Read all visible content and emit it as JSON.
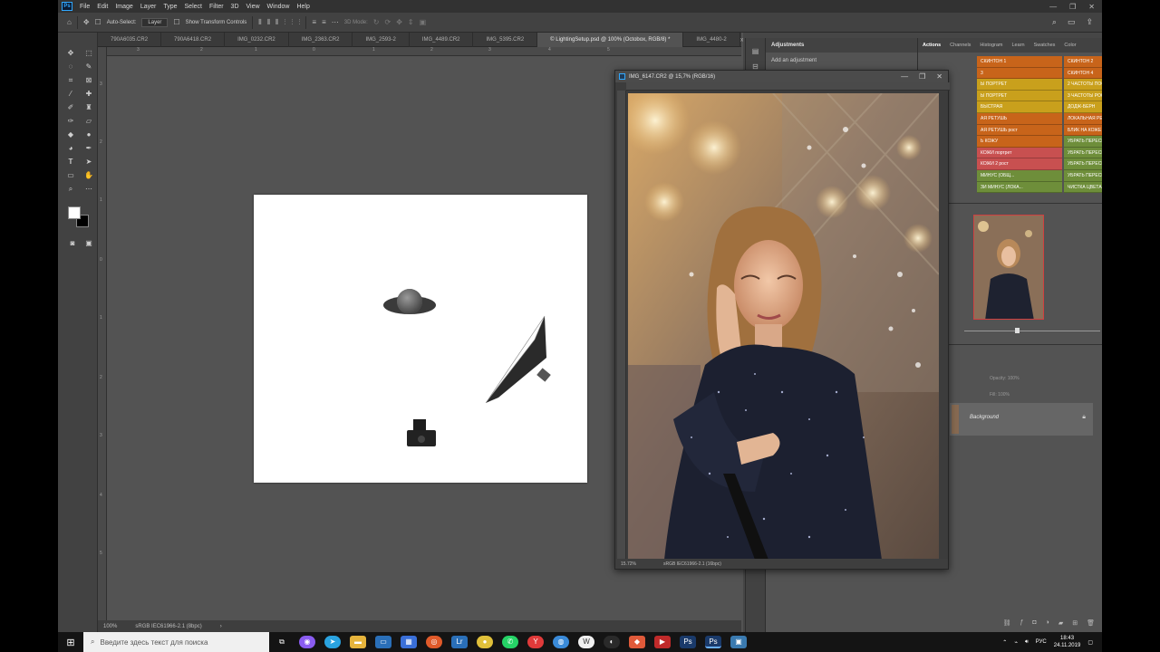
{
  "app": {
    "logo": "Ps",
    "menu": [
      "File",
      "Edit",
      "Image",
      "Layer",
      "Type",
      "Select",
      "Filter",
      "3D",
      "View",
      "Window",
      "Help"
    ],
    "window_controls": [
      "—",
      "❐",
      "✕"
    ]
  },
  "options_bar": {
    "auto_select_label": "Auto-Select:",
    "auto_select_value": "Layer",
    "transform_label": "Show Transform Controls",
    "mode_label": "3D Mode:"
  },
  "tabs": [
    "790A6035.CR2",
    "790A6418.CR2",
    "IMG_0232.CR2",
    "IMG_2363.CR2",
    "IMG_2593-2",
    "IMG_4489.CR2",
    "IMG_5395.CR2",
    "© LightingSetup.psd @ 100% (Octobox, RGB/8) *",
    "IMG_4480-2"
  ],
  "status_main": {
    "zoom": "100%",
    "profile": "sRGB IEC61966-2.1 (8bpc)"
  },
  "floating_window": {
    "title": "IMG_6147.CR2 @ 15,7% (RGB/16)",
    "zoom": "15.72%",
    "profile": "sRGB IEC61966-2.1 (16bpc)"
  },
  "adjustments": {
    "title": "Adjustments",
    "subtitle": "Add an adjustment"
  },
  "actions_panel": {
    "tabs": [
      "Actions",
      "Channels",
      "Histogram",
      "Learn",
      "Swatches",
      "Color"
    ],
    "left_col": [
      {
        "label": "СКИНТОН 1",
        "color": "#c8641a"
      },
      {
        "label": "3",
        "color": "#c8641a"
      },
      {
        "label": "Ы ПОРТРЕТ",
        "color": "#c9a01c"
      },
      {
        "label": "Ы ПОРТРЕТ",
        "color": "#c9a01c"
      },
      {
        "label": "БЫСТРАЯ",
        "color": "#c9a01c"
      },
      {
        "label": "АЯ РЕТУШЬ",
        "color": "#c8641a"
      },
      {
        "label": "АЯ РЕТУШЬ рост",
        "color": "#c8641a"
      },
      {
        "label": "Ь КОЖУ",
        "color": "#c8641a"
      },
      {
        "label": "КОЖИ портрет",
        "color": "#c85050"
      },
      {
        "label": "КОЖИ 2 рост",
        "color": "#c85050"
      },
      {
        "label": "МИНУС (ОБЩ...",
        "color": "#6e8e3a"
      },
      {
        "label": "ЗИ МИНУС (ЛОКА...",
        "color": "#6e8e3a"
      }
    ],
    "right_col": [
      {
        "label": "СКИНТОН 2",
        "color": "#c8641a"
      },
      {
        "label": "СКИНТОН 4",
        "color": "#c8641a"
      },
      {
        "label": "2 ЧАСТОТЫ ПОСТ",
        "color": "#c9a01c"
      },
      {
        "label": "3 ЧАСТОТЫ РОСТ",
        "color": "#c9a01c"
      },
      {
        "label": "ДОДЖ-БЕРН",
        "color": "#c9a01c"
      },
      {
        "label": "ЛОКАЛЬНАЯ РЕТУШЬ порт...",
        "color": "#c8641a"
      },
      {
        "label": "БЛИК НА КОЖЕ",
        "color": "#c8641a"
      },
      {
        "label": "УБРАТЬ ПЕРЕСВЕТ 1",
        "color": "#6e8e3a"
      },
      {
        "label": "УБРАТЬ ПЕРЕСВЕТ 2",
        "color": "#6e8e3a"
      },
      {
        "label": "УБРАТЬ ПЕРЕСВЕТ 3",
        "color": "#6e8e3a"
      },
      {
        "label": "УБРАТЬ ПЕРЕСВЕТ 4",
        "color": "#6e8e3a"
      },
      {
        "label": "ЧИСТКА ЦВЕТА 1",
        "color": "#6e8e3a"
      }
    ]
  },
  "layers": {
    "background_label": "Background",
    "opacity_label": "Opacity:",
    "opacity_value": "100%",
    "fill_label": "Fill:",
    "fill_value": "100%"
  },
  "taskbar": {
    "search_placeholder": "Введите здесь текст для поиска",
    "lang": "РУС",
    "time": "18:43",
    "date": "24.11.2019"
  }
}
